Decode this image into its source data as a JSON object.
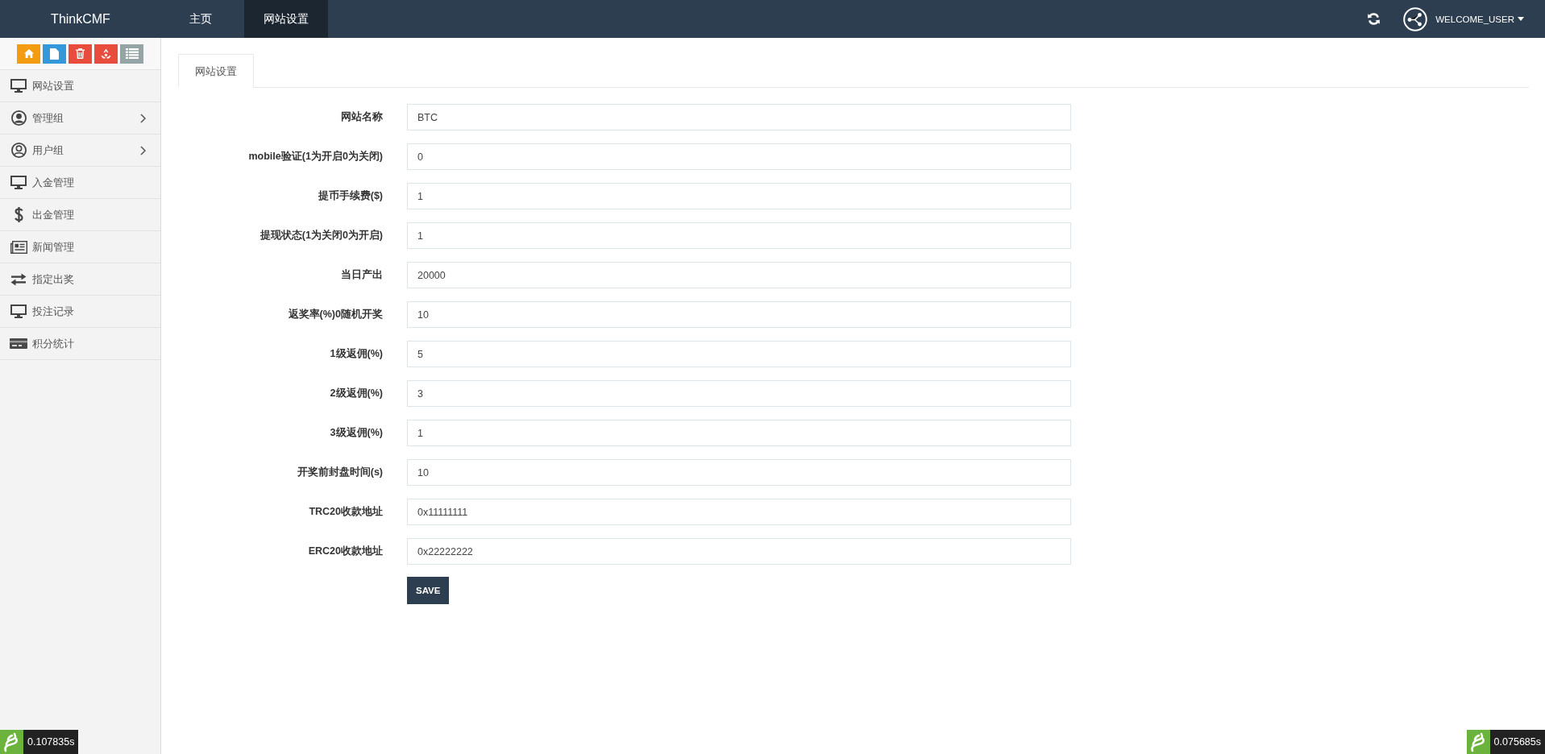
{
  "topbar": {
    "logo": "ThinkCMF",
    "nav": [
      {
        "label": "主页",
        "selected": false
      },
      {
        "label": "网站设置",
        "selected": true
      }
    ],
    "user": "WELCOME_USER"
  },
  "sidebar": {
    "toolbar": [
      {
        "kind": "home",
        "color": "#f39c12"
      },
      {
        "kind": "file",
        "color": "#3498db"
      },
      {
        "kind": "trash",
        "color": "#e74c3c"
      },
      {
        "kind": "recycle",
        "color": "#e74c3c"
      },
      {
        "kind": "list",
        "color": "#95a5a6"
      }
    ],
    "items": [
      {
        "label": "网站设置",
        "kind": "monitor",
        "submenu": false
      },
      {
        "label": "管理组",
        "kind": "account",
        "submenu": true
      },
      {
        "label": "用户组",
        "kind": "user",
        "submenu": true
      },
      {
        "label": "入金管理",
        "kind": "monitor",
        "submenu": false
      },
      {
        "label": "出金管理",
        "kind": "dollar",
        "submenu": false
      },
      {
        "label": "新闻管理",
        "kind": "newspaper",
        "submenu": false
      },
      {
        "label": "指定出奖",
        "kind": "exchange",
        "submenu": false
      },
      {
        "label": "投注记录",
        "kind": "monitor",
        "submenu": false
      },
      {
        "label": "积分统计",
        "kind": "card",
        "submenu": false
      }
    ]
  },
  "content": {
    "tabs": [
      {
        "label": "网站设置",
        "selected": true
      }
    ],
    "form": {
      "fields": [
        {
          "label": "网站名称",
          "value": "BTC"
        },
        {
          "label": "mobile验证(1为开启0为关闭)",
          "value": "0"
        },
        {
          "label": "提币手续费($)",
          "value": "1"
        },
        {
          "label": "提现状态(1为关闭0为开启)",
          "value": "1"
        },
        {
          "label": "当日产出",
          "value": "20000"
        },
        {
          "label": "返奖率(%)0随机开奖",
          "value": "10"
        },
        {
          "label": "1级返佣(%)",
          "value": "5"
        },
        {
          "label": "2级返佣(%)",
          "value": "3"
        },
        {
          "label": "3级返佣(%)",
          "value": "1"
        },
        {
          "label": "开奖前封盘时间(s)",
          "value": "10"
        },
        {
          "label": "TRC20收款地址",
          "value": "0x11111111"
        },
        {
          "label": "ERC20收款地址",
          "value": "0x22222222"
        }
      ],
      "submit": "SAVE"
    }
  },
  "page_trace": {
    "left": "0.107835s",
    "right": "0.075685s"
  }
}
